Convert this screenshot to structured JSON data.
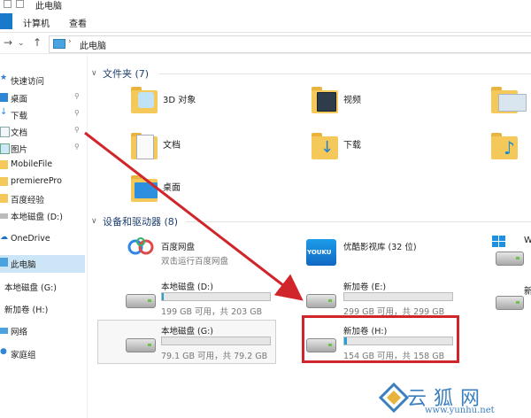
{
  "window": {
    "title": "此电脑"
  },
  "ribbon": {
    "tabs": [
      "计算机",
      "查看"
    ]
  },
  "address": {
    "location": "此电脑"
  },
  "sidebar": {
    "items": [
      {
        "label": "快速访问",
        "pinned": false
      },
      {
        "label": "桌面",
        "pinned": true
      },
      {
        "label": "下载",
        "pinned": true
      },
      {
        "label": "文档",
        "pinned": true
      },
      {
        "label": "图片",
        "pinned": true
      },
      {
        "label": "MobileFile",
        "pinned": false
      },
      {
        "label": "premierePro",
        "pinned": false
      },
      {
        "label": "百度经验",
        "pinned": false
      },
      {
        "label": "本地磁盘 (D:)",
        "pinned": false
      },
      {
        "label": "OneDrive",
        "pinned": false
      },
      {
        "label": "此电脑",
        "pinned": false
      },
      {
        "label": "本地磁盘 (G:)",
        "pinned": false
      },
      {
        "label": "新加卷 (H:)",
        "pinned": false
      },
      {
        "label": "网络",
        "pinned": false
      },
      {
        "label": "家庭组",
        "pinned": false
      }
    ]
  },
  "folders": {
    "heading": "文件夹 (7)",
    "items": [
      {
        "label": "3D 对象"
      },
      {
        "label": "视频"
      },
      {
        "label": "文档"
      },
      {
        "label": "下载"
      },
      {
        "label": "桌面"
      }
    ]
  },
  "devices": {
    "heading": "设备和驱动器 (8)",
    "baidu": {
      "name": "百度网盘",
      "subtitle": "双击运行百度网盘"
    },
    "youku": {
      "name": "优酷影视库 (32 位)",
      "logo_text": "YOUKU"
    },
    "drives": [
      {
        "name": "本地磁盘 (D:)",
        "free": "199 GB 可用，共 203 GB",
        "used_fraction": 0.02
      },
      {
        "name": "新加卷 (E:)",
        "free": "299 GB 可用，共 299 GB",
        "used_fraction": 0.0
      },
      {
        "name": "本地磁盘 (G:)",
        "free": "79.1 GB 可用，共 79.2 GB",
        "used_fraction": 0.0
      },
      {
        "name": "新加卷 (H:)",
        "free": "154 GB 可用，共 158 GB",
        "used_fraction": 0.025
      }
    ]
  },
  "watermark": {
    "text": "云狐网",
    "url": "www.yunhu.net"
  },
  "colors": {
    "accent": "#1979ca",
    "highlight": "#d0262b",
    "folder": "#f5c85a"
  }
}
